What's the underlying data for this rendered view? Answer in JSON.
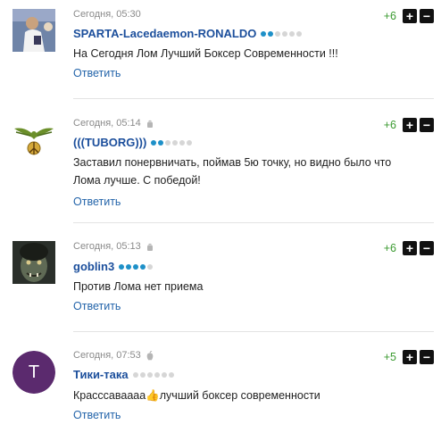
{
  "comments": [
    {
      "time": "Сегодня, 05:30",
      "author": "SPARTA-Lacedaemon-RONALDO",
      "rating_filled": 2,
      "rating_total": 6,
      "text": "На Сегодня Лом Лучший Боксер Современности !!!",
      "reply": "Ответить",
      "score": "+6",
      "device": "none",
      "avatar": "photo-football-player"
    },
    {
      "time": "Сегодня, 05:14",
      "author": "(((TUBORG)))",
      "rating_filled": 2,
      "rating_total": 6,
      "text": "Заставил понервничать, поймав 5ю точку, но видно было что Лома лучше. С победой!",
      "reply": "Ответить",
      "score": "+6",
      "device": "android-icon",
      "avatar": "eagle-peace-emblem"
    },
    {
      "time": "Сегодня, 05:13",
      "author": "goblin3",
      "rating_filled": 4,
      "rating_total": 5,
      "text": "Против Лома нет приема",
      "reply": "Ответить",
      "score": "+6",
      "device": "android-icon",
      "avatar": "photo-orc-face"
    },
    {
      "time": "Сегодня, 07:53",
      "author": "Тики-така",
      "rating_filled": 0,
      "rating_total": 6,
      "text": "Красссаваааа👍лучший боксер современности",
      "reply": "Ответить",
      "score": "+5",
      "device": "apple-icon",
      "avatar_letter": "Т",
      "avatar_color": "#5b2a6e"
    }
  ],
  "vote": {
    "plus": "+",
    "minus": "−"
  },
  "colors": {
    "author": "#1c4f9c",
    "reply": "#2364aa",
    "score": "#3a9a2f",
    "rating_on": "#1e90c8"
  }
}
